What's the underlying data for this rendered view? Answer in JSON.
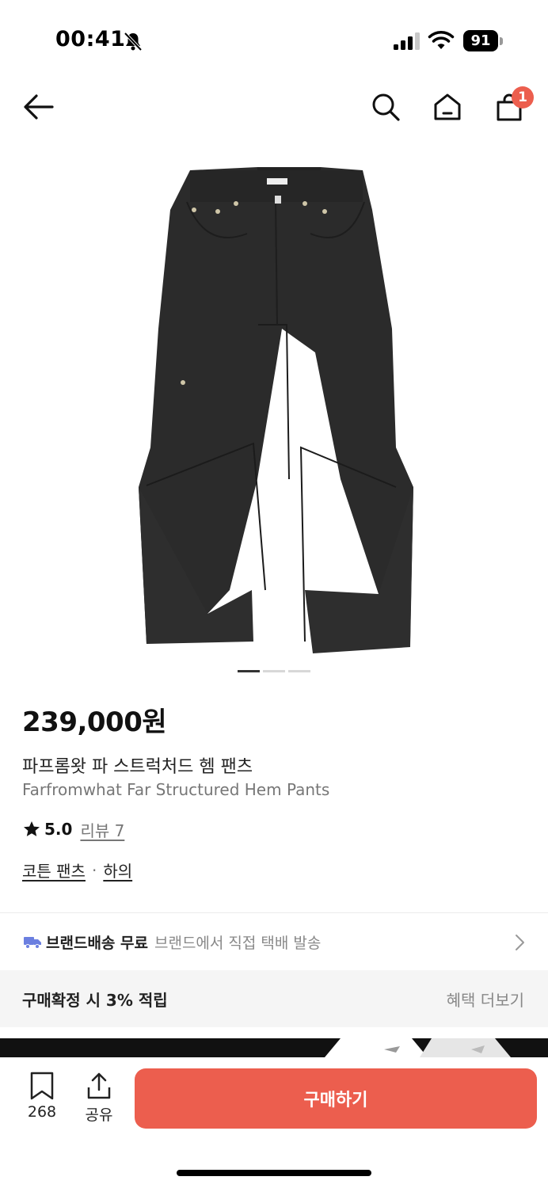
{
  "status": {
    "time": "00:41",
    "battery": "91"
  },
  "nav": {
    "cart_count": "1"
  },
  "gallery": {
    "pages": 3,
    "current": 0
  },
  "product": {
    "price": "239,000원",
    "name_ko": "파프롬왓 파 스트럭처드 헴 팬츠",
    "name_en": "Farfromwhat Far Structured Hem Pants",
    "rating": "5.0",
    "review_label": "리뷰 7",
    "category_primary": "코튼 팬츠",
    "category_separator": "·",
    "category_secondary": "하의",
    "color": "#2b2b2b"
  },
  "shipping": {
    "title": "브랜드배송 무료",
    "subtitle": "브랜드에서 직접 택배 발송"
  },
  "benefit": {
    "text": "구매확정 시 3% 적립",
    "more_label": "혜택 더보기"
  },
  "bottom": {
    "bookmark_count": "268",
    "share_label": "공유",
    "buy_label": "구매하기"
  },
  "colors": {
    "accent": "#ec5e4e",
    "text": "#111111",
    "muted": "#888888",
    "truck": "#6b7fe0"
  }
}
